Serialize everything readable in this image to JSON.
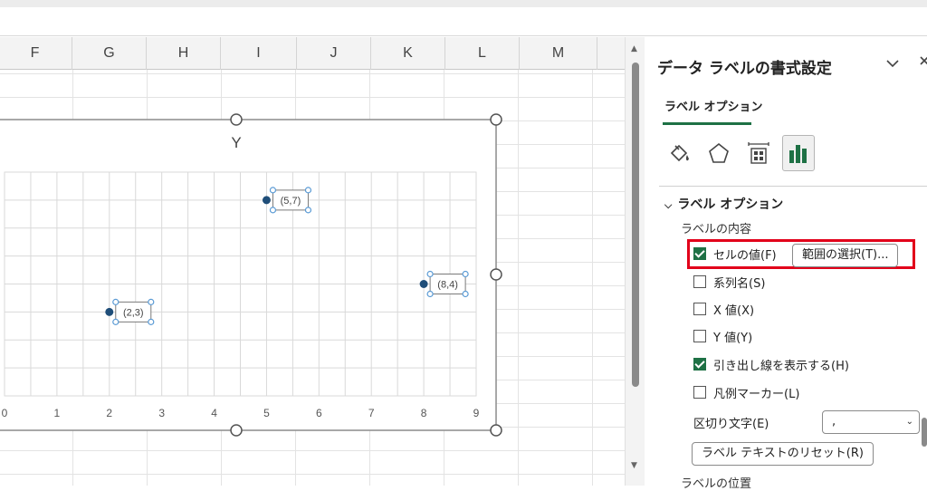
{
  "sheet": {
    "columns": [
      "F",
      "G",
      "H",
      "I",
      "J",
      "K",
      "L",
      "M"
    ]
  },
  "chart": {
    "title": "Y",
    "x_ticks": [
      "0",
      "1",
      "2",
      "3",
      "4",
      "5",
      "6",
      "7",
      "8",
      "9"
    ],
    "labels": [
      "(5,7)",
      "(2,3)",
      "(8,4)"
    ]
  },
  "chart_data": {
    "type": "scatter",
    "title": "Y",
    "xlabel": "",
    "ylabel": "",
    "xlim": [
      0,
      9
    ],
    "ylim": [
      0,
      8
    ],
    "grid": true,
    "points": [
      {
        "x": 5,
        "y": 7,
        "label": "(5,7)"
      },
      {
        "x": 2,
        "y": 3,
        "label": "(2,3)"
      },
      {
        "x": 8,
        "y": 4,
        "label": "(8,4)"
      }
    ],
    "marker_color": "#1f4e79"
  },
  "pane": {
    "title": "データ ラベルの書式設定",
    "tab": "ラベル オプション",
    "icons": [
      "paint-bucket-icon",
      "pentagon-icon",
      "size-properties-icon",
      "bar-chart-icon"
    ],
    "section_title": "ラベル オプション",
    "label_contents_title": "ラベルの内容",
    "options": [
      {
        "label": "セルの値(F)",
        "checked": true
      },
      {
        "label": "系列名(S)",
        "checked": false
      },
      {
        "label": "X 値(X)",
        "checked": false
      },
      {
        "label": "Y 値(Y)",
        "checked": false
      },
      {
        "label": "引き出し線を表示する(H)",
        "checked": true
      },
      {
        "label": "凡例マーカー(L)",
        "checked": false
      }
    ],
    "select_range_button": "範囲の選択(T)...",
    "separator_label": "区切り文字(E)",
    "separator_value": ",",
    "reset_button": "ラベル テキストのリセット(R)",
    "label_position_title": "ラベルの位置"
  },
  "colors": {
    "accent": "#1e7145",
    "highlight": "#e2001a",
    "handle": "#5b9bd5"
  }
}
